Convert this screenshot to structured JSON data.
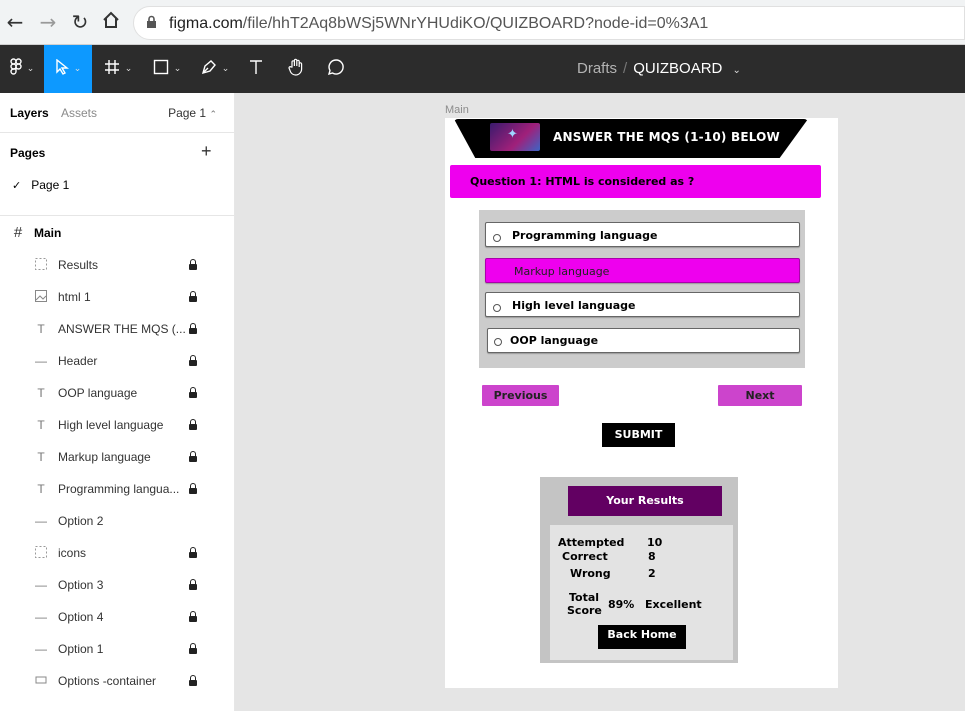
{
  "browser": {
    "url_host": "figma.com",
    "url_path": "/file/hhT2Aq8bWSj5WNrYHUdiKO/QUIZBOARD?node-id=0%3A1"
  },
  "toolbar": {
    "drafts": "Drafts",
    "separator": "/",
    "file_name": "QUIZBOARD",
    "accent": "#0d99ff"
  },
  "panel": {
    "tabs": [
      "Layers",
      "Assets"
    ],
    "page_selector": "Page 1",
    "pages_heading": "Pages",
    "pages": [
      "Page 1"
    ],
    "main_frame": "Main",
    "layers": [
      {
        "name": "Results",
        "icon": "frame-dashed-icon",
        "locked": true
      },
      {
        "name": "html 1",
        "icon": "image-icon",
        "locked": true
      },
      {
        "name": "ANSWER THE MQS (...",
        "icon": "text-icon",
        "locked": true
      },
      {
        "name": "Header",
        "icon": "line-icon",
        "locked": true
      },
      {
        "name": "OOP language",
        "icon": "text-icon",
        "locked": true
      },
      {
        "name": "High level language",
        "icon": "text-icon",
        "locked": true
      },
      {
        "name": "Markup language",
        "icon": "text-icon",
        "locked": true
      },
      {
        "name": "Programming langua...",
        "icon": "text-icon",
        "locked": true
      },
      {
        "name": "Option 2",
        "icon": "line-icon",
        "locked": false
      },
      {
        "name": "icons",
        "icon": "frame-dashed-icon",
        "locked": true
      },
      {
        "name": "Option 3",
        "icon": "line-icon",
        "locked": true
      },
      {
        "name": "Option 4",
        "icon": "line-icon",
        "locked": true
      },
      {
        "name": "Option 1",
        "icon": "line-icon",
        "locked": true
      },
      {
        "name": "Options -container",
        "icon": "rectangle-icon",
        "locked": true
      }
    ]
  },
  "canvas": {
    "frame_label": "Main",
    "header_text": "ANSWER THE MQS (1-10) BELOW",
    "question": "Question 1: HTML is considered as  ?",
    "options": [
      "Programming language",
      "Markup language",
      "High level language",
      "OOP language"
    ],
    "selected_option_index": 1,
    "previous_label": "Previous",
    "next_label": "Next",
    "submit_label": "SUBMIT",
    "results_title": "Your Results",
    "attempted_label": "Attempted",
    "attempted_value": "10",
    "correct_label": "Correct",
    "correct_value": "8",
    "wrong_label": "Wrong",
    "wrong_value": "2",
    "total_label_1": "Total",
    "total_label_2": "Score",
    "score_value": "89%",
    "grade": "Excellent",
    "back_home_label": "Back Home",
    "colors": {
      "magenta": "#ee00ee",
      "nav_button": "#cc44cc",
      "results_header": "#620062"
    }
  }
}
